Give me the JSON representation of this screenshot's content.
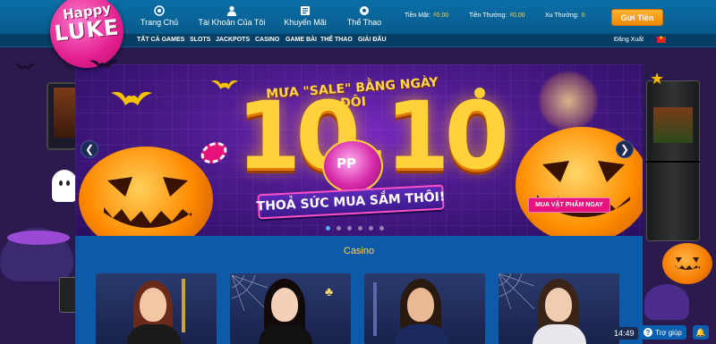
{
  "brand": {
    "logo_line1": "Happy",
    "logo_line2": "LUKE"
  },
  "nav": {
    "items": [
      {
        "label": "Trang Chủ",
        "icon": "casino-chip-icon"
      },
      {
        "label": "Tài Khoản Của Tôi",
        "icon": "user-icon"
      },
      {
        "label": "Khuyến Mãi",
        "icon": "promotion-icon"
      },
      {
        "label": "Thể Thao",
        "icon": "soccer-ball-icon"
      }
    ]
  },
  "balances": {
    "cash_label": "Tiền Mặt:",
    "cash_value": "₫0.00",
    "bonus_label": "Tiền Thưởng:",
    "bonus_value": "₫0.00",
    "coins_label": "Xu Thưởng:",
    "coins_value": "0"
  },
  "deposit_label": "Gửi Tiền",
  "subnav": {
    "items": [
      "TẤT CẢ GAMES",
      "SLOTS",
      "JACKPOTS",
      "CASINO",
      "GAME BÀI",
      "THỂ THAO",
      "GIẢI ĐẤU"
    ],
    "logout_label": "Đăng Xuất",
    "language_flag": "vietnam-flag-icon"
  },
  "banner": {
    "headline": "MƯA \"SALE\" BẰNG NGÀY ĐÔI",
    "big_number": "10.10",
    "badge": "PP",
    "tagline": "THOẢ SỨC MUA SẮM THÔI!",
    "cta_label": "MUA VẬT PHẨM NGAY",
    "slide_count": 6,
    "active_slide": 1
  },
  "casino": {
    "title": "Casino",
    "cards": [
      "dealer-card-1",
      "dealer-card-2",
      "dealer-card-3",
      "dealer-card-4"
    ]
  },
  "widgets": {
    "time": "14:49",
    "help_label": "Trợ giúp"
  },
  "colors": {
    "header": "#0a6fa6",
    "accent": "#ffd24a",
    "deposit": "#f08a00",
    "cta": "#e8147e",
    "section": "#0d5aa8"
  }
}
